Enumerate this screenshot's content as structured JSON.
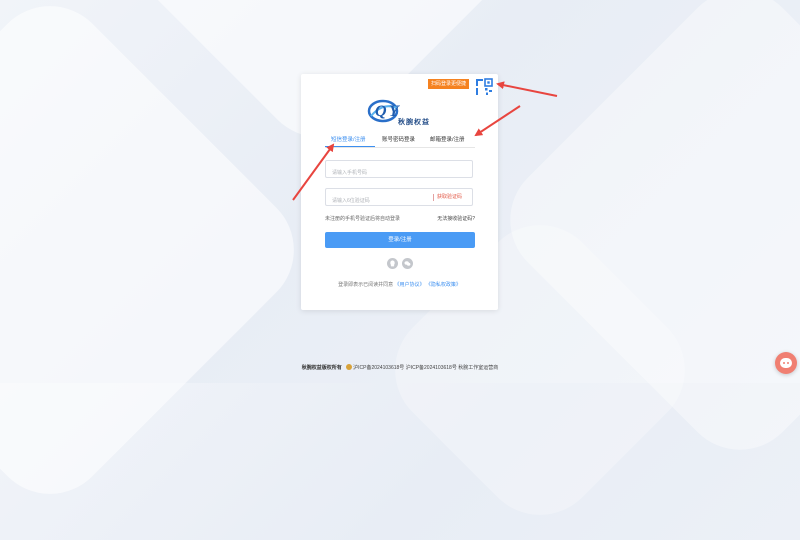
{
  "qr": {
    "tip": "扫码登录更便捷"
  },
  "brand": {
    "name": "秋腕权益"
  },
  "tabs": [
    {
      "label": "短信登录/注册"
    },
    {
      "label": "账号密码登录"
    },
    {
      "label": "邮箱登录/注册"
    }
  ],
  "form": {
    "phone_placeholder": "请输入手机号码",
    "code_placeholder": "请输入6位验证码",
    "get_code": "获取验证码",
    "hint_left": "未注册的手机号验证后将自动登录",
    "hint_right": "无法接收验证码?",
    "submit": "登录/注册"
  },
  "agreement": {
    "prefix": "登录即表示已阅读并同意",
    "user_agreement": "《用户协议》",
    "privacy_policy": "《隐私权政策》"
  },
  "footer": {
    "owner": "秋腕权益版权所有",
    "icp1": "沪ICP备2024103618号",
    "icp2": "沪ICP备2024103618号",
    "studio": "秋腕工作室运营商"
  },
  "colors": {
    "accent": "#3c8ff0",
    "button": "#4a9bf5",
    "tip": "#f58220",
    "arrow": "#e8453f"
  }
}
